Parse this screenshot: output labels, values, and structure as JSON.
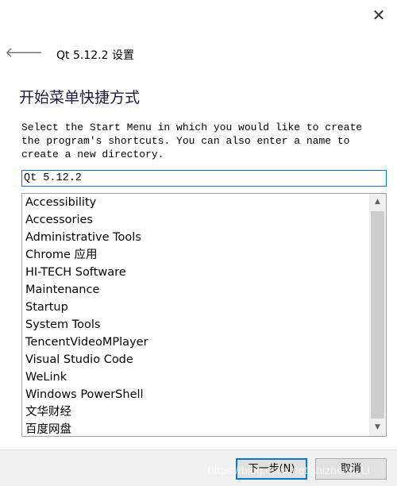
{
  "window": {
    "title": "Qt 5.12.2 设置",
    "close_icon": "close-icon",
    "back_icon": "arrow-left-icon"
  },
  "page": {
    "heading": "开始菜单快捷方式",
    "description": "Select the Start Menu in which you would like to create\nthe program's shortcuts. You can also enter a name to\ncreate a new directory."
  },
  "directory_input": {
    "value": "Qt 5.12.2"
  },
  "folders": [
    "Accessibility",
    "Accessories",
    "Administrative Tools",
    "Chrome 应用",
    "HI-TECH Software",
    "Maintenance",
    "Startup",
    "System Tools",
    "TencentVideoMPlayer",
    "Visual Studio Code",
    "WeLink",
    "Windows PowerShell",
    "文华财经",
    "百度网盘"
  ],
  "buttons": {
    "next": "下一步(N)",
    "cancel": "取消"
  },
  "watermark": "https://blog.csdn.net/shizheng_Li",
  "colors": {
    "accent": "#0078d7"
  }
}
